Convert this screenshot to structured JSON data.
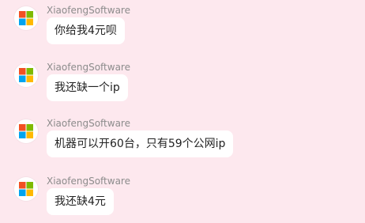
{
  "colors": {
    "background": "#fde8ee",
    "bubble": "#ffffff",
    "sender_name": "#8c8c8c",
    "text": "#222222",
    "logo_red": "#f25022",
    "logo_green": "#7fba00",
    "logo_blue": "#00a4ef",
    "logo_yellow": "#ffb900"
  },
  "messages": [
    {
      "sender": "XiaofengSoftware",
      "avatar_icon": "windows-logo-icon",
      "text": "你给我4元呗"
    },
    {
      "sender": "XiaofengSoftware",
      "avatar_icon": "windows-logo-icon",
      "text": "我还缺一个ip"
    },
    {
      "sender": "XiaofengSoftware",
      "avatar_icon": "windows-logo-icon",
      "text": "机器可以开60台，只有59个公网ip"
    },
    {
      "sender": "XiaofengSoftware",
      "avatar_icon": "windows-logo-icon",
      "text": "我还缺4元"
    }
  ]
}
